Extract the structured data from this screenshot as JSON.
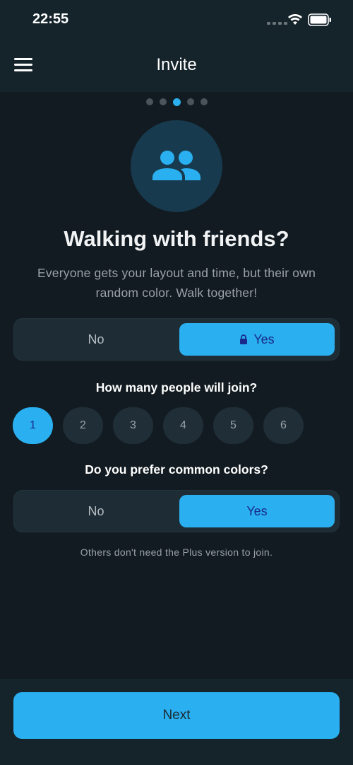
{
  "status_bar": {
    "time": "22:55"
  },
  "header": {
    "title": "Invite"
  },
  "pager": {
    "count": 5,
    "active_index": 2
  },
  "hero": {
    "icon": "people-group-icon",
    "title": "Walking with friends?",
    "subtitle": "Everyone gets your layout and time, but their own random color. Walk together!"
  },
  "toggle_walking": {
    "no_label": "No",
    "yes_label": "Yes",
    "selected": "Yes",
    "yes_icon": "lock-icon"
  },
  "people_question": "How many people will join?",
  "people_options": [
    "1",
    "2",
    "3",
    "4",
    "5",
    "6"
  ],
  "people_selected": "1",
  "colors_question": "Do you prefer common colors?",
  "toggle_colors": {
    "no_label": "No",
    "yes_label": "Yes",
    "selected": "Yes"
  },
  "footnote": "Others don't need the Plus version to join.",
  "next_button": "Next",
  "colors": {
    "accent": "#2ab0f0",
    "background": "#121b21",
    "surface": "#1d2c35",
    "selected_text": "#1a2a8a"
  }
}
